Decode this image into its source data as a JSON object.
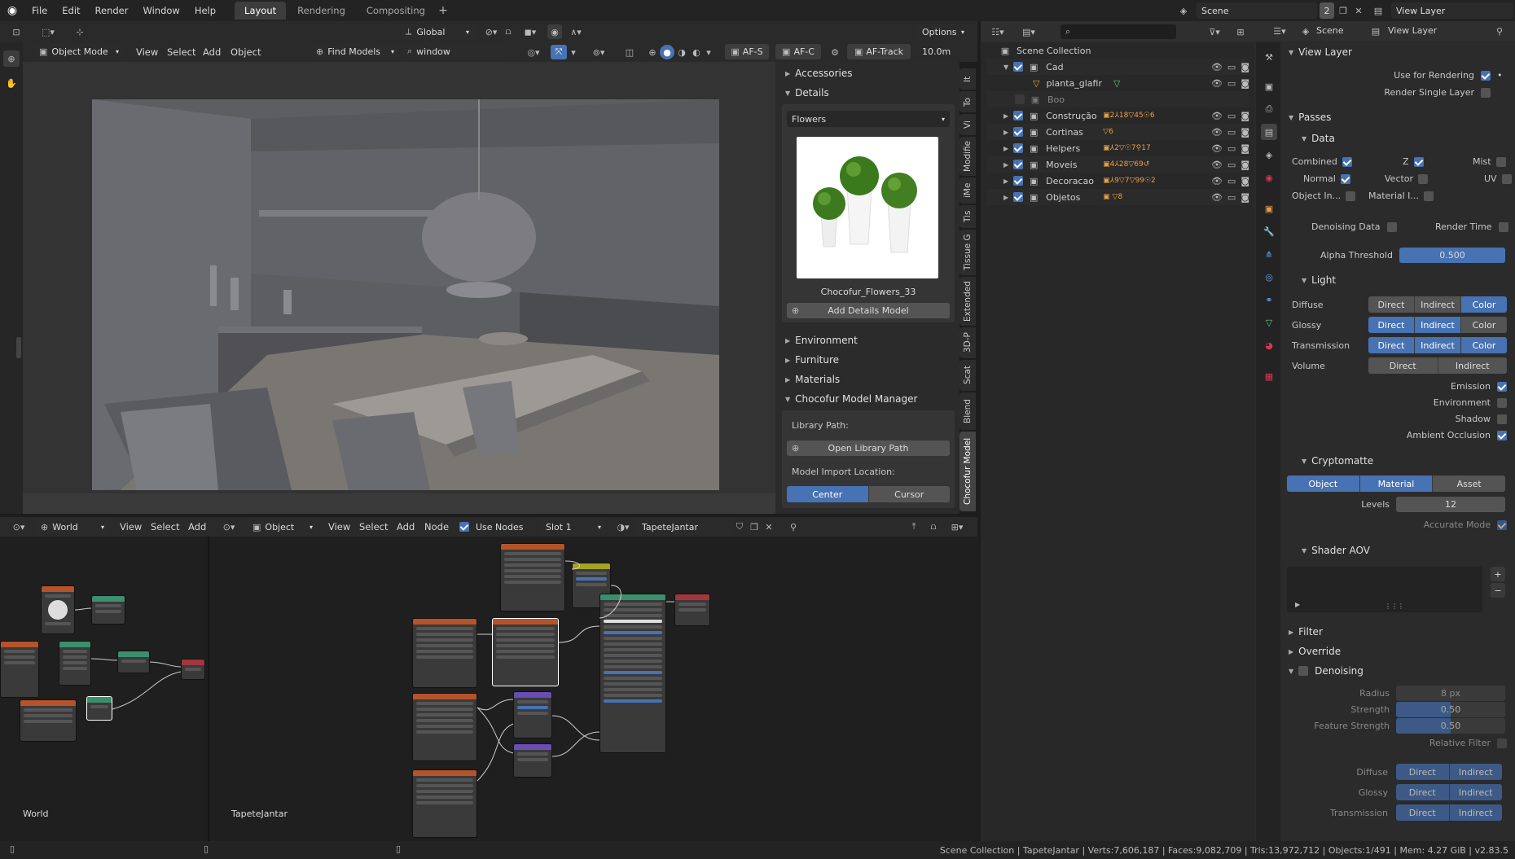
{
  "menu": [
    "File",
    "Edit",
    "Render",
    "Window",
    "Help"
  ],
  "workspaces": [
    "Layout",
    "Rendering",
    "Compositing"
  ],
  "scene": {
    "label": "Scene",
    "count": "2",
    "view_layer": "View Layer"
  },
  "header3d": {
    "transform": "Global",
    "options": "Options",
    "mode": "Object Mode",
    "menus": [
      "View",
      "Select",
      "Add",
      "Object"
    ],
    "find_models": "Find Models",
    "search_value": "window",
    "af_s": "AF-S",
    "af_c": "AF-C",
    "af_track": "AF-Track",
    "distance": "10.0m"
  },
  "npanel": {
    "accessories": "Accessories",
    "details": "Details",
    "category": "Flowers",
    "model_name": "Chocofur_Flowers_33",
    "add_details": "Add Details Model",
    "environment": "Environment",
    "furniture": "Furniture",
    "materials": "Materials",
    "manager": "Chocofur Model Manager",
    "library_path": "Library Path:",
    "open_library": "Open Library Path",
    "import_location": "Model Import Location:",
    "center": "Center",
    "cursor": "Cursor"
  },
  "vtabs": [
    "It",
    "To",
    "Vi",
    "Modifie",
    "iMe",
    "Tis",
    "Tissue G",
    "Extended",
    "3D-P",
    "Scat",
    "Blend",
    "Chocofur Model"
  ],
  "outliner": {
    "search_placeholder": "",
    "root": "Scene Collection",
    "items": [
      {
        "name": "Cad",
        "counts": []
      },
      {
        "name": "planta_glafir",
        "counts": []
      },
      {
        "name": "Boo",
        "counts": []
      },
      {
        "name": "Construção",
        "counts": [
          "2",
          "18",
          "45",
          "6"
        ]
      },
      {
        "name": "Cortinas",
        "counts": [
          "6"
        ]
      },
      {
        "name": "Helpers",
        "counts": [
          "2",
          "7",
          "17"
        ]
      },
      {
        "name": "Moveis",
        "counts": [
          "4",
          "28",
          "69"
        ]
      },
      {
        "name": "Decoracao",
        "counts": [
          "9",
          "7",
          "99",
          "2"
        ]
      },
      {
        "name": "Objetos",
        "counts": [
          "8"
        ]
      }
    ]
  },
  "properties": {
    "scene_tab": "Scene",
    "view_layer_tab": "View Layer",
    "view_layer": "View Layer",
    "use_for_rendering": "Use for Rendering",
    "render_single": "Render Single Layer",
    "passes": "Passes",
    "data": "Data",
    "combined": "Combined",
    "z": "Z",
    "mist": "Mist",
    "normal": "Normal",
    "vector": "Vector",
    "uv": "UV",
    "object_index": "Object In...",
    "material_index": "Material I...",
    "denoising_data": "Denoising Data",
    "render_time": "Render Time",
    "alpha_threshold": "Alpha Threshold",
    "alpha_value": "0.500",
    "light": "Light",
    "diffuse": "Diffuse",
    "glossy": "Glossy",
    "transmission": "Transmission",
    "volume": "Volume",
    "direct": "Direct",
    "indirect": "Indirect",
    "color": "Color",
    "emission": "Emission",
    "environment": "Environment",
    "shadow": "Shadow",
    "ambient_occlusion": "Ambient Occlusion",
    "cryptomatte": "Cryptomatte",
    "crypto_object": "Object",
    "crypto_material": "Material",
    "crypto_asset": "Asset",
    "levels": "Levels",
    "levels_value": "12",
    "accurate_mode": "Accurate Mode",
    "shader_aov": "Shader AOV",
    "filter": "Filter",
    "override": "Override",
    "denoising": "Denoising",
    "radius": "Radius",
    "radius_value": "8 px",
    "strength": "Strength",
    "strength_value": "0.50",
    "feature_strength": "Feature Strength",
    "feature_value": "0.50",
    "relative_filter": "Relative Filter",
    "d_diffuse": "Diffuse",
    "d_glossy": "Glossy",
    "d_transmission": "Transmission"
  },
  "node_left": {
    "world": "World",
    "menus": [
      "View",
      "Select",
      "Add"
    ],
    "label": "World"
  },
  "node_right": {
    "object": "Object",
    "menus": [
      "View",
      "Select",
      "Add",
      "Node"
    ],
    "use_nodes": "Use Nodes",
    "slot": "Slot 1",
    "material": "TapeteJantar",
    "label": "TapeteJantar"
  },
  "status": "Scene Collection | TapeteJantar | Verts:7,606,187 | Faces:9,082,709 | Tris:13,972,712 | Objects:1/491 | Mem: 4.27 GiB | v2.83.5",
  "colors": {
    "accent": "#4772b3",
    "bg": "#1d1d1d",
    "panel": "#303030"
  }
}
